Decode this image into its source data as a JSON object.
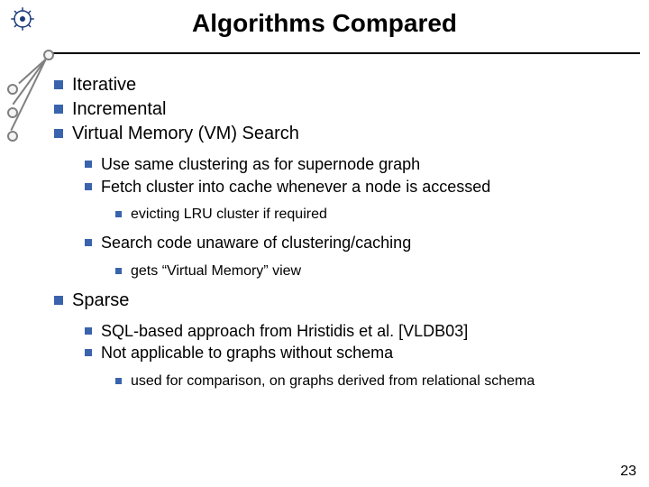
{
  "slide": {
    "title": "Algorithms Compared",
    "page_number": "23",
    "items": {
      "iterative": "Iterative",
      "incremental": "Incremental",
      "vm_search": "Virtual Memory (VM) Search",
      "vm_sub": {
        "use_same_clustering": "Use same clustering as for supernode graph",
        "fetch_cluster": "Fetch cluster into cache whenever a node is accessed",
        "evicting_lru": "evicting LRU cluster if required",
        "search_unaware": "Search code unaware of clustering/caching",
        "gets_vm_view": "gets “Virtual Memory” view"
      },
      "sparse": "Sparse",
      "sparse_sub": {
        "sql_based": "SQL-based approach from Hristidis et al. [VLDB03]",
        "not_applicable": "Not applicable to graphs without schema",
        "used_for_comparison": "used for comparison, on graphs derived from relational schema"
      }
    }
  }
}
